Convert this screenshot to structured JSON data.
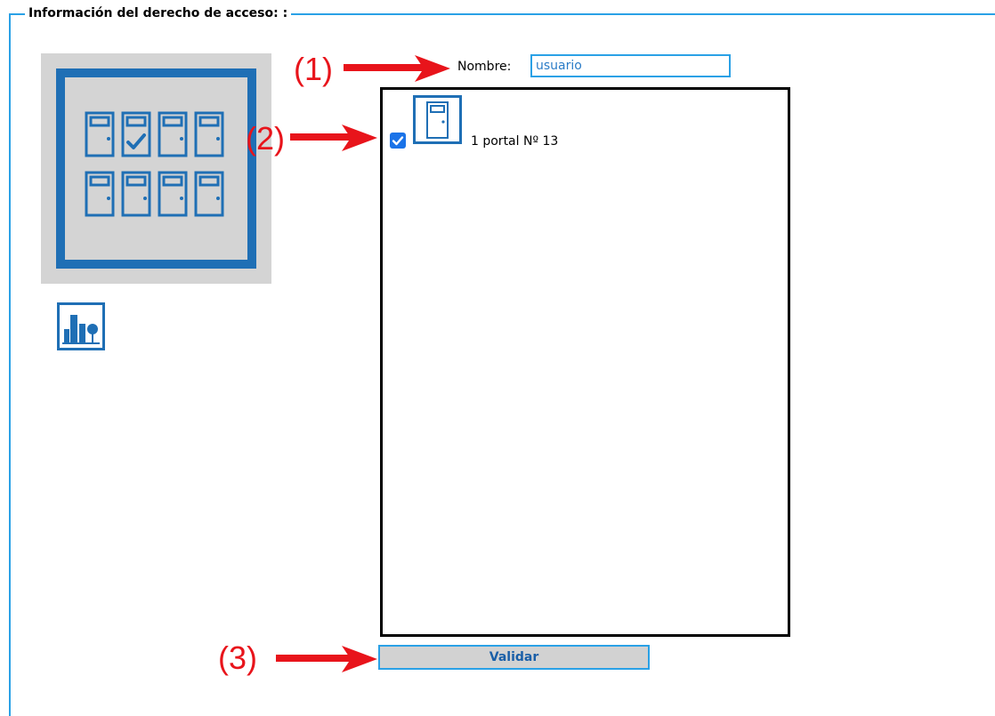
{
  "section": {
    "legend": "Información del derecho de acceso: :"
  },
  "form": {
    "name_label": "Nombre:",
    "name_value": "usuario"
  },
  "door_list": {
    "items": [
      {
        "label": "1 portal Nº 13",
        "checked": true,
        "icon": "door-icon"
      }
    ]
  },
  "actions": {
    "validate_label": "Validar"
  },
  "annotations": {
    "step1": "(1)",
    "step2": "(2)",
    "step3": "(3)"
  },
  "icons": {
    "module_image": "door-grid-icon",
    "site_icon": "building-tree-icon"
  },
  "colors": {
    "accent": "#2aa1e6",
    "icon_blue": "#1f6fb5",
    "annotation_red": "#e8141b",
    "button_text": "#1a5fa8"
  }
}
